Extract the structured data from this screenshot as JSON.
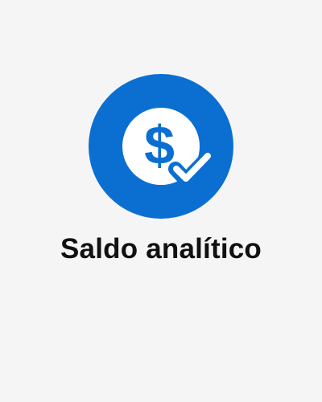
{
  "tile": {
    "label": "Saldo analítico",
    "icon": "dollar-check-icon",
    "accent_color": "#0b6fd1",
    "background_color": "#f5f5f5"
  }
}
